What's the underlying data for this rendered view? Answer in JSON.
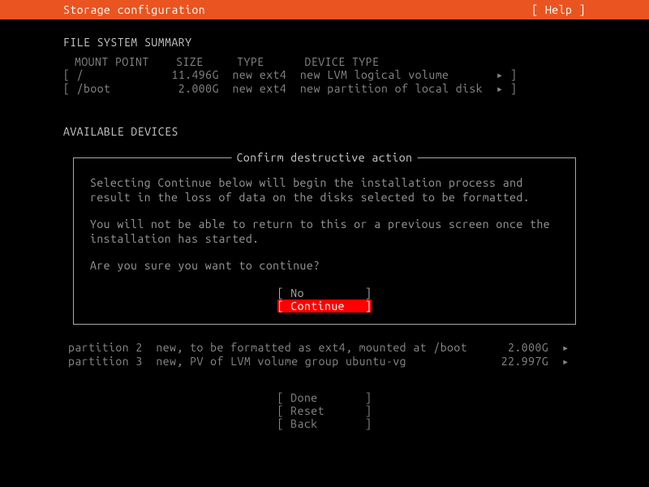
{
  "header": {
    "title": "Storage configuration",
    "help": "[ Help ]"
  },
  "fs_summary": {
    "title": "FILE SYSTEM SUMMARY",
    "header": "MOUNT POINT    SIZE     TYPE      DEVICE TYPE",
    "rows": [
      "[ /             11.496G  new ext4  new LVM logical volume       ▸ ]",
      "[ /boot          2.000G  new ext4  new partition of local disk  ▸ ]"
    ]
  },
  "available": {
    "title": "AVAILABLE DEVICES"
  },
  "dialog": {
    "title": "Confirm destructive action",
    "p1": "Selecting Continue below will begin the installation process and result in the loss of data on the disks selected to be formatted.",
    "p2": "You will not be able to return to this or a previous screen once the installation has started.",
    "p3": "Are you sure you want to continue?",
    "no": "[ No         ]",
    "continue": "[ Continue   ]"
  },
  "partitions": [
    "partition 2  new, to be formatted as ext4, mounted at /boot      2.000G  ▸",
    "partition 3  new, PV of LVM volume group ubuntu-vg              22.997G  ▸"
  ],
  "bottom": {
    "done": "[ Done       ]",
    "reset": "[ Reset      ]",
    "back": "[ Back       ]"
  }
}
